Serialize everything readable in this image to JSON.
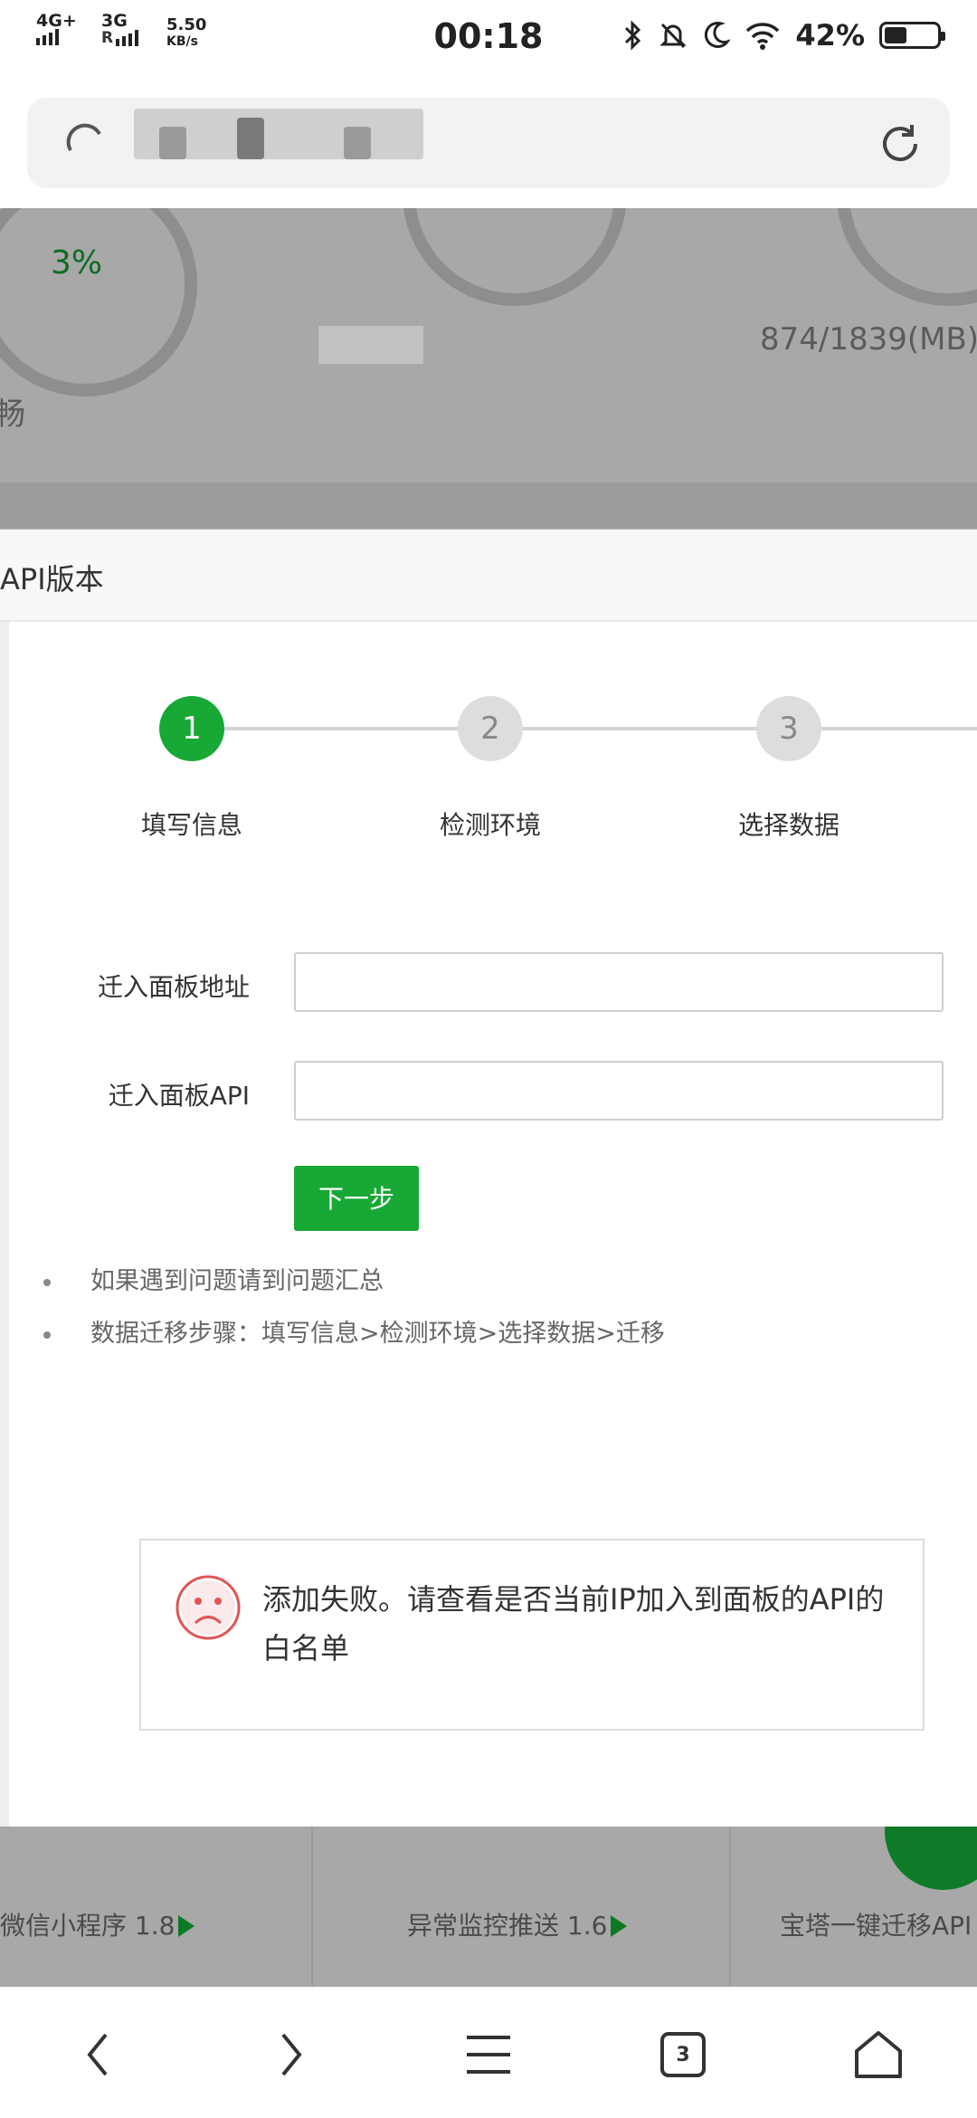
{
  "status_bar": {
    "network_primary": "4G+",
    "network_secondary": "3G",
    "speed_value": "5.50",
    "speed_unit": "KB/s",
    "time": "00:18",
    "battery_level": "42%",
    "battery_fraction": 0.42
  },
  "background_page": {
    "gauge_1_value": "3%",
    "memory_usage": "874/1839(MB)",
    "left_fragment": "畅",
    "bottom_items": [
      {
        "label": "微信小程序 1.8"
      },
      {
        "label": "异常监控推送 1.6"
      },
      {
        "label": "宝塔一键迁移API"
      }
    ]
  },
  "modal": {
    "title": "API版本",
    "steps": [
      {
        "number": "1",
        "label": "填写信息",
        "active": true
      },
      {
        "number": "2",
        "label": "检测环境",
        "active": false
      },
      {
        "number": "3",
        "label": "选择数据",
        "active": false
      }
    ],
    "form": {
      "panel_address_label": "迁入面板地址",
      "panel_address_value": "",
      "panel_api_label": "迁入面板API",
      "panel_api_value": "",
      "next_button": "下一步"
    },
    "tips": [
      "如果遇到问题请到问题汇总",
      "数据迁移步骤：填写信息>检测环境>选择数据>迁移"
    ],
    "error_message": "添加失败。请查看是否当前IP加入到面板的API的白名单"
  },
  "bottom_nav": {
    "tab_count": "3"
  },
  "colors": {
    "accent_green": "#17a836",
    "step_inactive": "#dddddd",
    "error_red": "#e05555"
  },
  "icons": {
    "back": "chevron-left-icon",
    "forward": "chevron-right-icon",
    "menu": "menu-icon",
    "tabs": "tabs-icon",
    "home": "home-icon",
    "reload": "reload-icon",
    "error": "sad-face-icon"
  }
}
